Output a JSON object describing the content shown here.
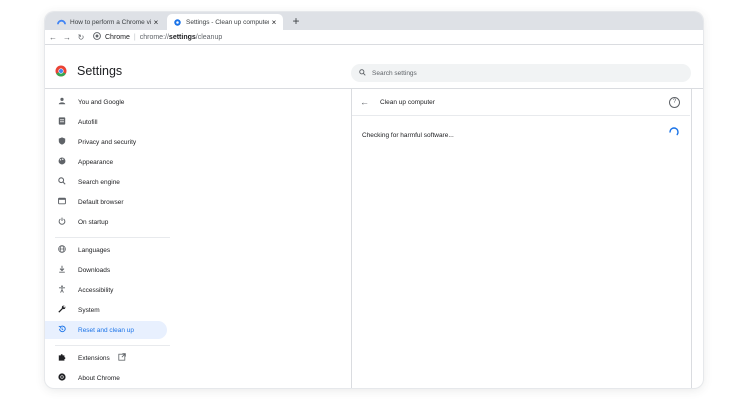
{
  "browser": {
    "tabs": [
      {
        "title": "How to perform a Chrome virus s",
        "active": false,
        "icon": "chrome-help-icon"
      },
      {
        "title": "Settings - Clean up computer",
        "active": true,
        "icon": "settings-gear-icon"
      }
    ],
    "new_tab_symbol": "+",
    "close_symbol": "×",
    "omnibox": {
      "site_label": "Chrome",
      "url_host": "chrome://",
      "url_path": "settings",
      "url_rest": "/cleanup"
    }
  },
  "settings": {
    "title": "Settings",
    "search_placeholder": "Search settings"
  },
  "sidebar": {
    "items": [
      {
        "label": "You and Google",
        "icon": "person-icon"
      },
      {
        "label": "Autofill",
        "icon": "autofill-icon"
      },
      {
        "label": "Privacy and security",
        "icon": "shield-icon"
      },
      {
        "label": "Appearance",
        "icon": "palette-icon"
      },
      {
        "label": "Search engine",
        "icon": "search-icon"
      },
      {
        "label": "Default browser",
        "icon": "browser-icon"
      },
      {
        "label": "On startup",
        "icon": "power-icon"
      },
      {
        "label": "Languages",
        "icon": "globe-icon"
      },
      {
        "label": "Downloads",
        "icon": "download-icon"
      },
      {
        "label": "Accessibility",
        "icon": "accessibility-icon"
      },
      {
        "label": "System",
        "icon": "wrench-icon"
      },
      {
        "label": "Reset and clean up",
        "icon": "restore-icon",
        "selected": true
      },
      {
        "label": "Extensions",
        "icon": "puzzle-icon"
      },
      {
        "label": "About Chrome",
        "icon": "chrome-icon"
      }
    ]
  },
  "panel": {
    "title": "Clean up computer",
    "status_text": "Checking for harmful software..."
  },
  "colors": {
    "accent": "#1a73e8",
    "selected_bg": "#e8f0fe",
    "tab_strip": "#dee1e6"
  }
}
